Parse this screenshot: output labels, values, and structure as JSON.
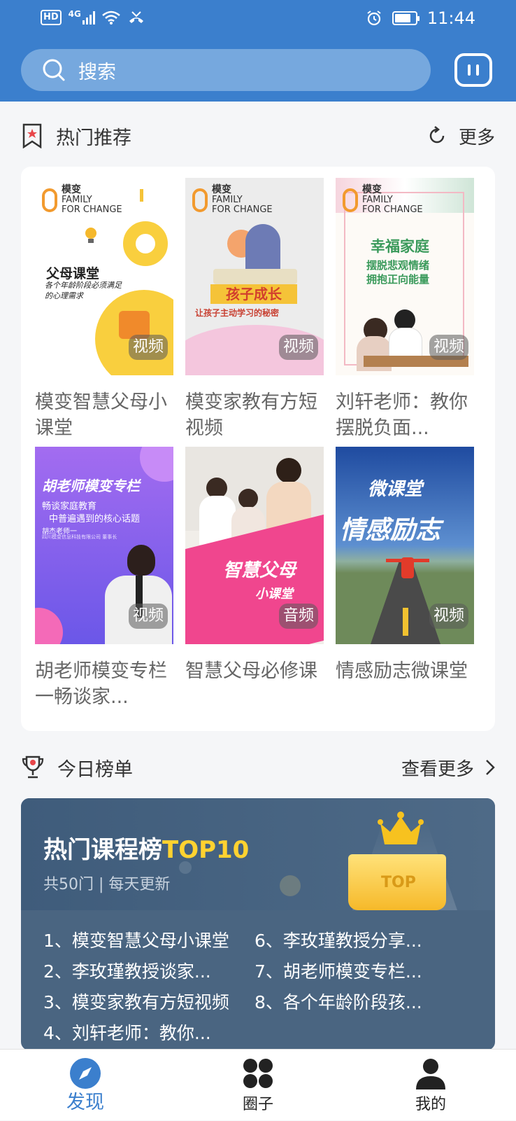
{
  "status_bar": {
    "hd": "HD",
    "net": "4G",
    "time": "11:44"
  },
  "search": {
    "placeholder": "搜索"
  },
  "hot": {
    "title": "热门推荐",
    "more": "更多",
    "items": [
      {
        "title": "模变智慧父母小课堂",
        "badge": "视频",
        "cover_text": [
          "父母课堂",
          "各个年龄阶段必须满足的心理需求"
        ]
      },
      {
        "title": "模变家教有方短视频",
        "badge": "视频",
        "cover_text": [
          "孩子成长",
          "让孩子主动学习的秘密"
        ]
      },
      {
        "title": "刘轩老师：教你摆脱负面...",
        "badge": "视频",
        "cover_text": [
          "幸福家庭",
          "摆脱悲观情绪",
          "拥抱正向能量"
        ]
      },
      {
        "title": "胡老师模变专栏一畅谈家...",
        "badge": "视频",
        "cover_text": [
          "胡老师模变专栏",
          "畅谈家庭教育",
          "中普遍遇到的核心话题",
          "胡杰老师一",
          "四川模变信息科技有限公司 董事长"
        ]
      },
      {
        "title": "智慧父母必修课",
        "badge": "音频",
        "cover_text": [
          "智慧父母",
          "小课堂"
        ]
      },
      {
        "title": "情感励志微课堂",
        "badge": "视频",
        "cover_text": [
          "微课堂",
          "情感励志"
        ]
      }
    ],
    "logo": {
      "name": "模变",
      "sub1": "FAMILY",
      "sub2": "FOR CHANGE"
    }
  },
  "ranking": {
    "title": "今日榜单",
    "more": "查看更多",
    "banner_title": "热门课程榜",
    "banner_title_highlight": "TOP10",
    "banner_sub": "共50门 | 每天更新",
    "trophy_label": "TOP",
    "list": [
      "1、模变智慧父母小课堂",
      "2、李玫瑾教授谈家...",
      "3、模变家教有方短视频",
      "4、刘轩老师：教你...",
      "6、李玫瑾教授分享...",
      "7、胡老师模变专栏...",
      "8、各个年龄阶段孩..."
    ]
  },
  "tabs": [
    {
      "label": "发现",
      "icon": "compass-icon",
      "active": true
    },
    {
      "label": "圈子",
      "icon": "circles-icon",
      "active": false
    },
    {
      "label": "我的",
      "icon": "person-icon",
      "active": false
    }
  ],
  "colors": {
    "primary": "#3b7fcd",
    "highlight": "#ffd230",
    "banner": "#4a6581"
  }
}
